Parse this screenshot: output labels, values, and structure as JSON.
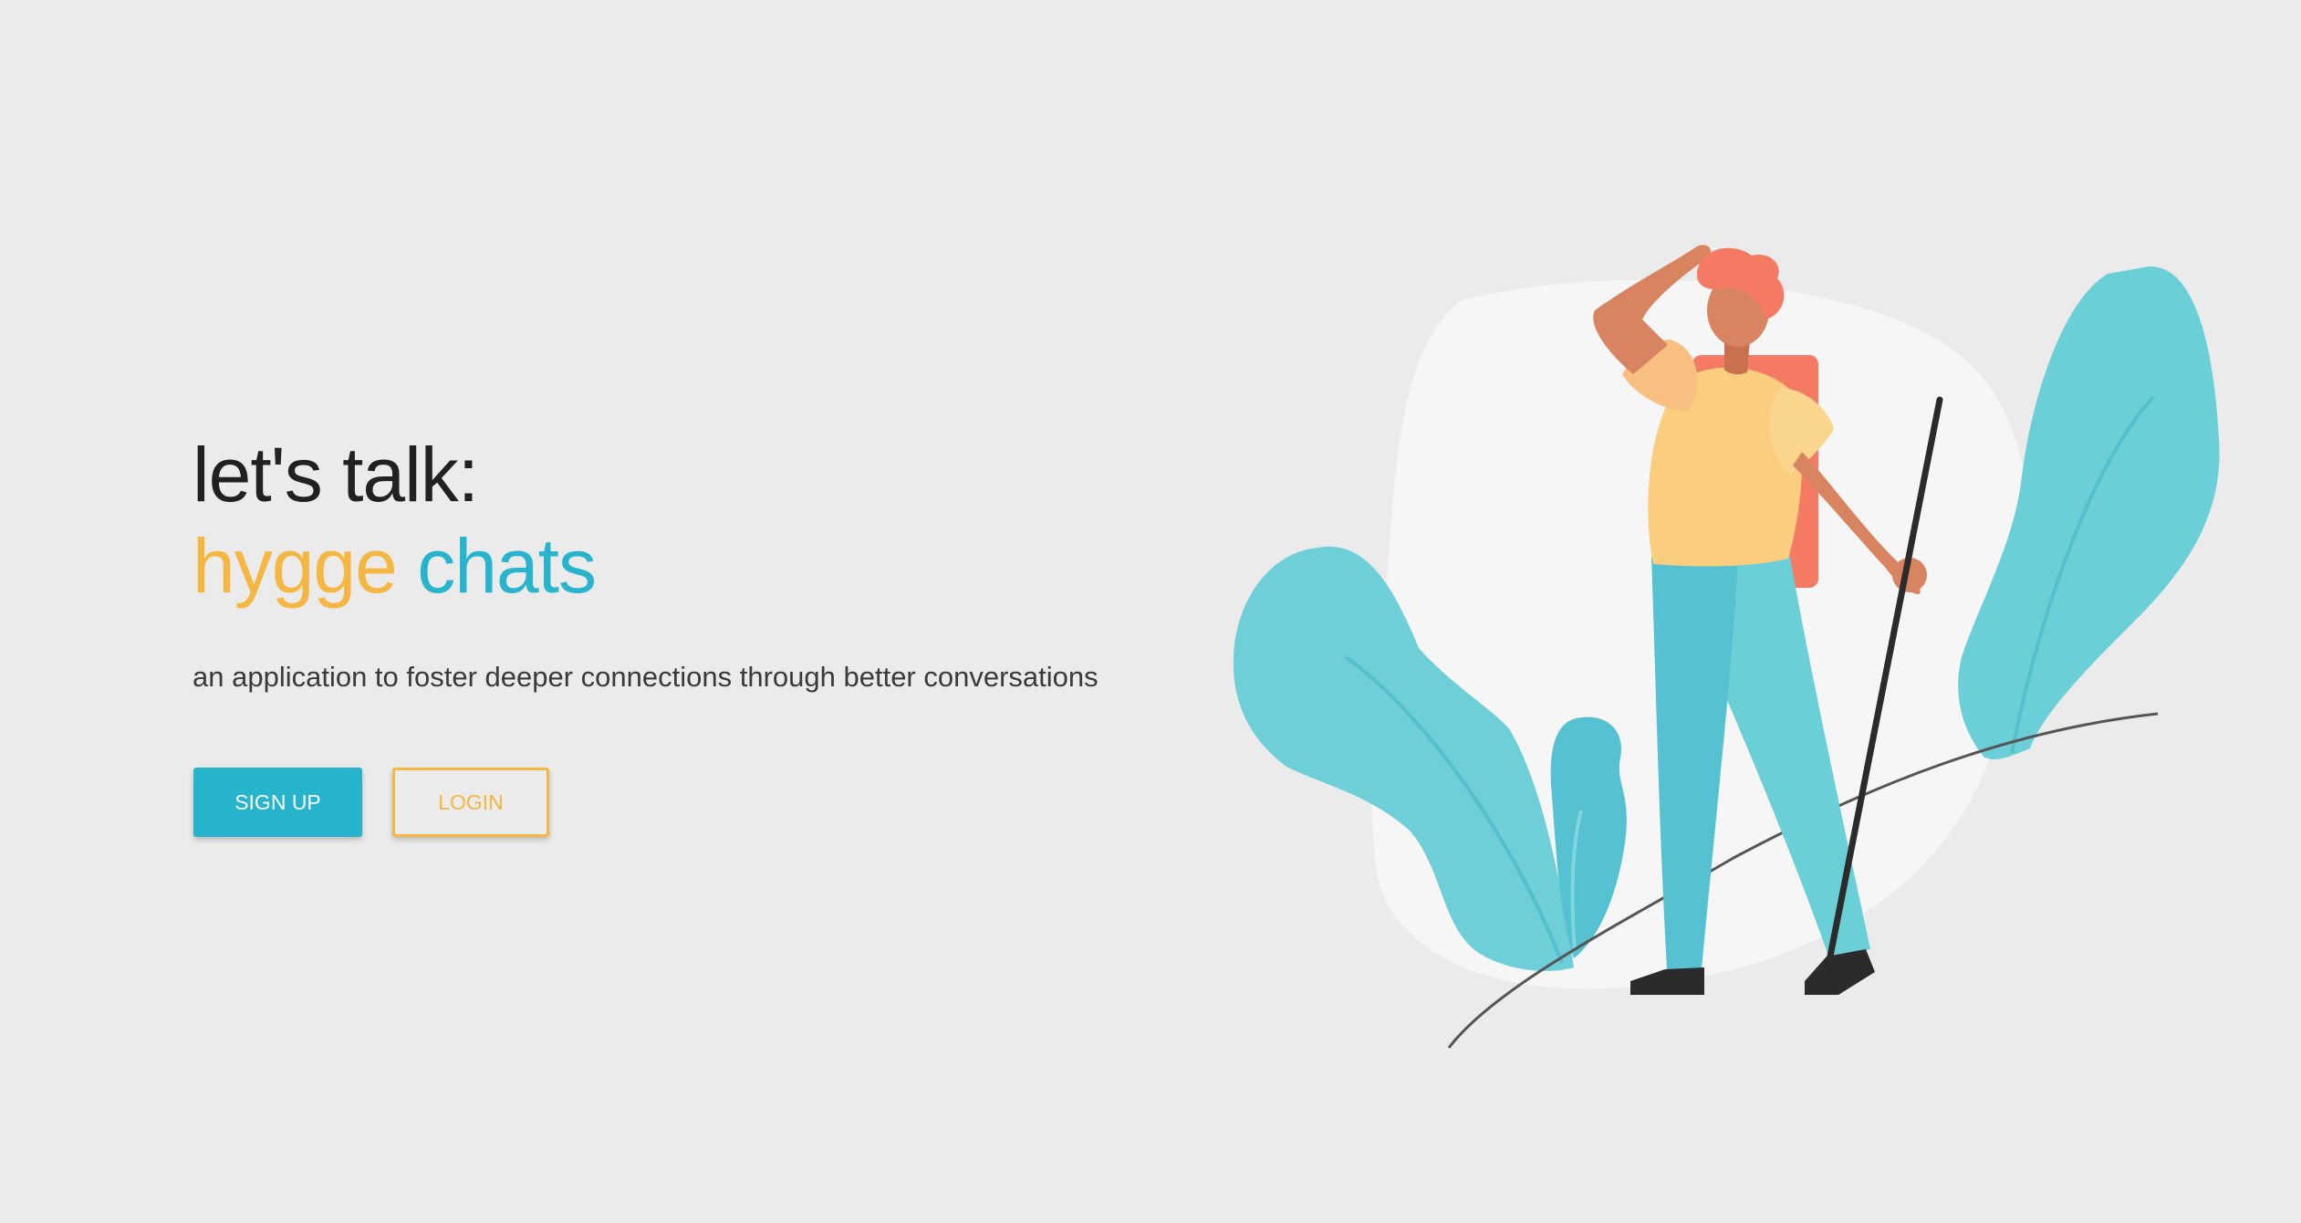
{
  "hero": {
    "heading_line_1": "let's talk:",
    "brand_word_1": "hygge",
    "brand_word_2": "chats",
    "tagline": "an application to foster deeper connections through better conversations"
  },
  "actions": {
    "signup_label": "SIGN UP",
    "login_label": "LOGIN"
  },
  "colors": {
    "background": "#ebebeb",
    "accent_yellow": "#f5b642",
    "accent_teal": "#29b4ce"
  },
  "illustration": {
    "name": "hiker-with-plants-illustration"
  }
}
